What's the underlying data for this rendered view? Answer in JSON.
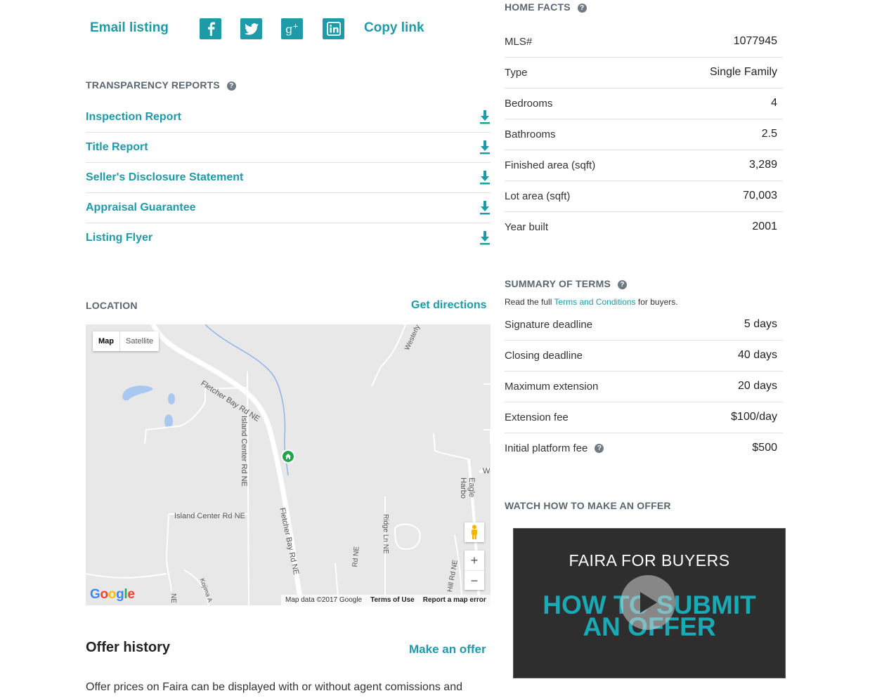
{
  "share": {
    "email_label": "Email listing",
    "copy_label": "Copy link",
    "icons": [
      "facebook-icon",
      "twitter-icon",
      "google-plus-icon",
      "linkedin-icon"
    ],
    "accent": "#1f9aa8"
  },
  "transparency": {
    "title": "TRANSPARENCY REPORTS",
    "reports": [
      {
        "label": "Inspection Report"
      },
      {
        "label": "Title Report"
      },
      {
        "label": "Seller's Disclosure Statement"
      },
      {
        "label": "Appraisal Guarantee"
      },
      {
        "label": "Listing Flyer"
      }
    ]
  },
  "location": {
    "title": "LOCATION",
    "directions_label": "Get directions",
    "map": {
      "tab_map": "Map",
      "tab_satellite": "Satellite",
      "streets": {
        "fletcher_top": "Fletcher Bay Rd NE",
        "fletcher_bottom": "Fletcher Bay Rd NE",
        "island_center_v": "Island Center Rd NE",
        "island_center_h": "Island Center Rd NE",
        "ridge": "Ridge Ln NE",
        "eagle": "Eagle Harbo",
        "westerly": "Westerly",
        "kojima": "Kojima A",
        "ne_label": "NE",
        "ne_road": "Rd NE",
        "hill": "Hill Rd NE",
        "w": "W",
        "e": "E"
      },
      "logo": "Google",
      "attribution": "Map data ©2017 Google",
      "terms": "Terms of Use",
      "report_error": "Report a map error"
    }
  },
  "offer_history": {
    "title": "Offer history",
    "make_offer_label": "Make an offer",
    "body": "Offer prices on Faira can be displayed with or without agent comissions and"
  },
  "home_facts": {
    "title": "HOME FACTS",
    "rows": [
      {
        "k": "MLS#",
        "v": "1077945"
      },
      {
        "k": "Type",
        "v": "Single Family"
      },
      {
        "k": "Bedrooms",
        "v": "4"
      },
      {
        "k": "Bathrooms",
        "v": "2.5"
      },
      {
        "k": "Finished area (sqft)",
        "v": "3,289"
      },
      {
        "k": "Lot area (sqft)",
        "v": "70,003"
      },
      {
        "k": "Year built",
        "v": "2001"
      }
    ]
  },
  "summary_terms": {
    "title": "SUMMARY OF TERMS",
    "note_prefix": "Read the full ",
    "note_link": "Terms and Conditions",
    "note_suffix": " for buyers.",
    "rows": [
      {
        "k": "Signature deadline",
        "v": "5 days"
      },
      {
        "k": "Closing deadline",
        "v": "40 days"
      },
      {
        "k": "Maximum extension",
        "v": "20 days"
      },
      {
        "k": "Extension fee",
        "v": "$100/day"
      },
      {
        "k": "Initial platform fee",
        "v": "$500"
      }
    ]
  },
  "video": {
    "section_title": "WATCH HOW TO MAKE AN OFFER",
    "line1": "FAIRA FOR BUYERS",
    "line2": "HOW TO SUBMIT",
    "line3": "AN OFFER"
  }
}
